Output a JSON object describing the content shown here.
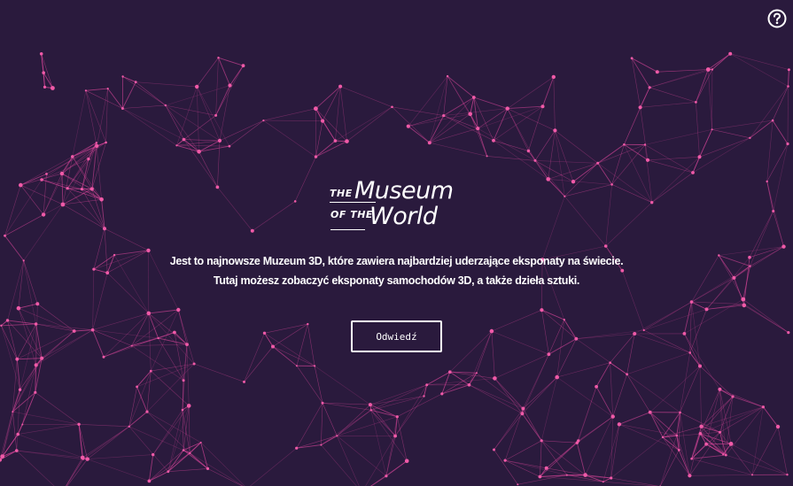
{
  "logo": {
    "the_top": "THE",
    "museum": "Museum",
    "the_bottom": "OF THE",
    "world": "World"
  },
  "description": {
    "line1": "Jest to najnowsze Muzeum 3D, które zawiera najbardziej uderzające eksponaty na świecie.",
    "line2": "Tutaj możesz zobaczyć eksponaty samochodów 3D, a także dzieła sztuki."
  },
  "buttons": {
    "visit_label": "Odwiedź",
    "help_icon": "question-mark-circle-icon"
  },
  "colors": {
    "background": "#2a1a3d",
    "network_line": "#e0479e",
    "network_node": "#f05aa8",
    "text": "#ffffff"
  }
}
